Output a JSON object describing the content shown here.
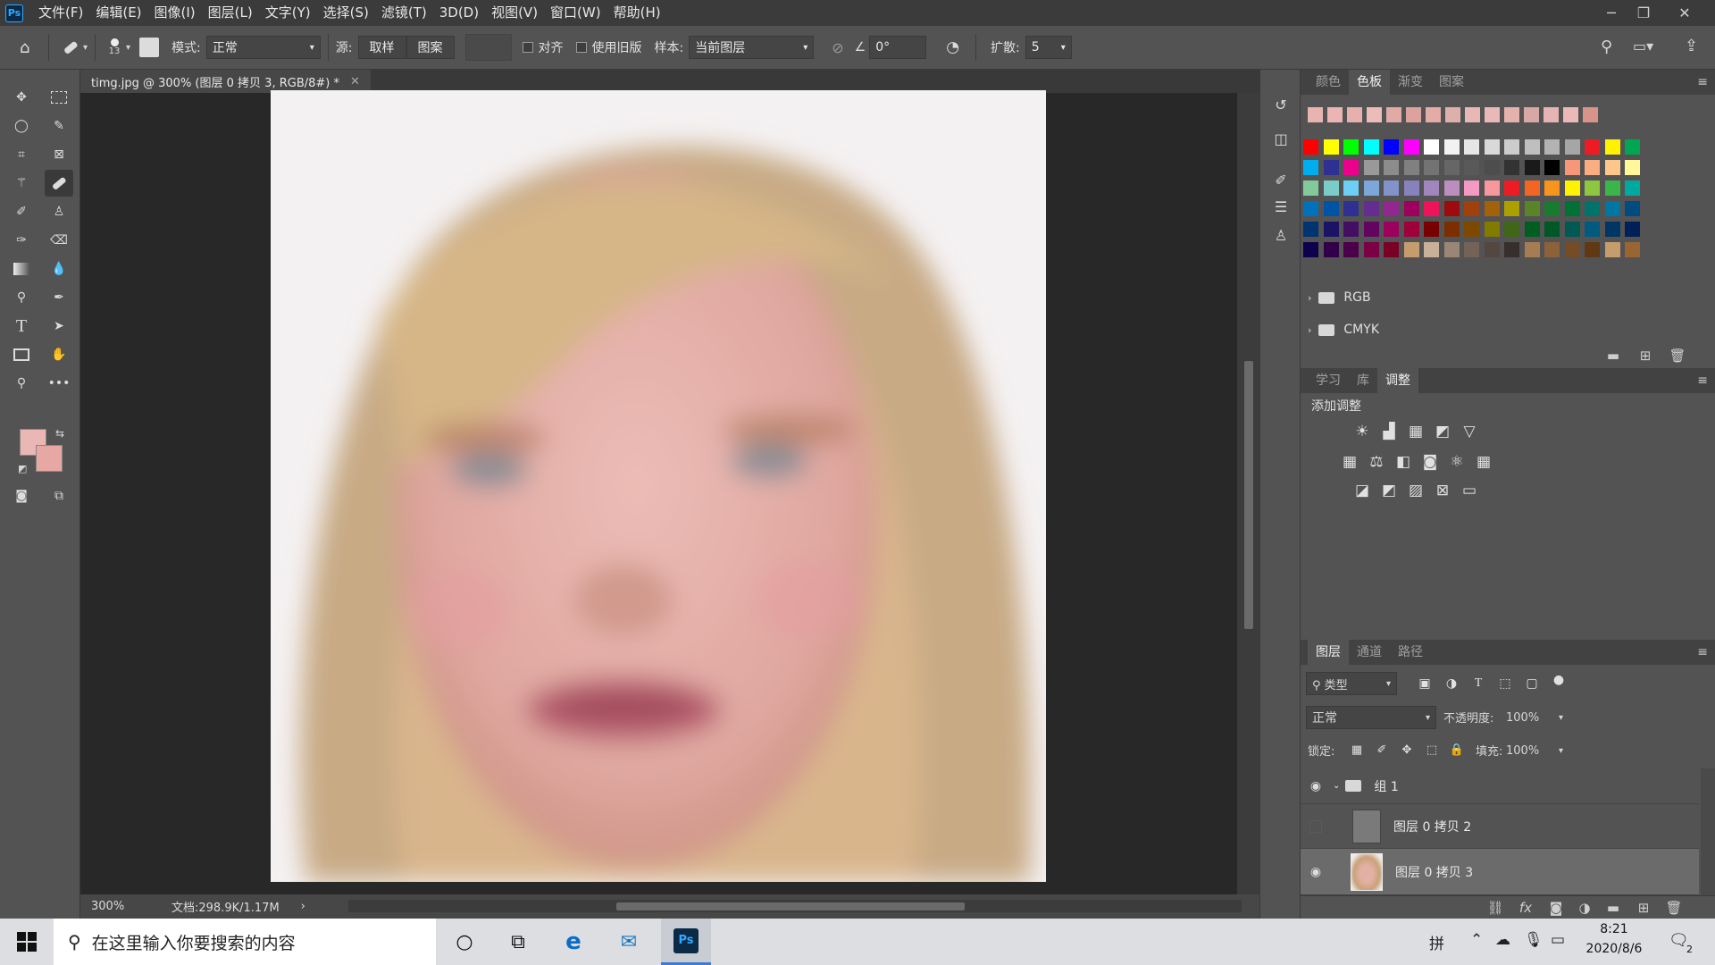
{
  "app": {
    "logo": "Ps"
  },
  "menu": [
    "文件(F)",
    "编辑(E)",
    "图像(I)",
    "图层(L)",
    "文字(Y)",
    "选择(S)",
    "滤镜(T)",
    "3D(D)",
    "视图(V)",
    "窗口(W)",
    "帮助(H)"
  ],
  "options": {
    "brush_size": "13",
    "mode_label": "模式:",
    "mode_value": "正常",
    "source_label": "源:",
    "sample_btn": "取样",
    "pattern_btn": "图案",
    "align_label": "对齐",
    "legacy_label": "使用旧版",
    "sample_label": "样本:",
    "sample_value": "当前图层",
    "angle_value": "0°",
    "diffuse_label": "扩散:",
    "diffuse_value": "5"
  },
  "document": {
    "tab_title": "timg.jpg @ 300% (图层 0 拷贝 3, RGB/8#) *",
    "zoom": "300%",
    "doc_info": "文档:298.9K/1.17M"
  },
  "swatches_panel": {
    "tabs": [
      "颜色",
      "色板",
      "渐变",
      "图案"
    ],
    "active_tab": "色板",
    "recent": [
      "#e8b4b0",
      "#eab5b3",
      "#e6b0ac",
      "#ecbcb8",
      "#e2aaa5",
      "#dca29d",
      "#e4aca7",
      "#deb0ab",
      "#e8b8b4",
      "#eab8b6",
      "#e4b2ad",
      "#d8a8a4",
      "#e6b4b2",
      "#ebb9b8",
      "#d8948a"
    ],
    "grid": [
      [
        "#ff0000",
        "#ffff00",
        "#00ff00",
        "#00ffff",
        "#0000ff",
        "#ff00ff",
        "#ffffff",
        "#f2f2f2",
        "#e6e6e6",
        "#d9d9d9",
        "#cccccc",
        "#bfbfbf",
        "#b3b3b3",
        "#a6a6a6",
        "#ed1c24",
        "#fff200",
        "#00a651"
      ],
      [
        "#00aeef",
        "#2e3192",
        "#ec008c",
        "#999999",
        "#8c8c8c",
        "#808080",
        "#737373",
        "#666666",
        "#595959",
        "#4d4d4d",
        "#333333",
        "#1a1a1a",
        "#000000",
        "#f7977a",
        "#f9ad81",
        "#fdc68a",
        "#fff79a"
      ],
      [
        "#82ca9c",
        "#7accc8",
        "#6dcff6",
        "#7da7d9",
        "#8393ca",
        "#8781bd",
        "#a186be",
        "#bc8dbf",
        "#f49ac2",
        "#f6989d",
        "#ed1c24",
        "#f26522",
        "#f7941d",
        "#fff200",
        "#8dc73f",
        "#39b54a",
        "#00a99d"
      ],
      [
        "#0072bc",
        "#0054a6",
        "#2e3192",
        "#662d91",
        "#92278f",
        "#9e005d",
        "#ed145b",
        "#9e0b0f",
        "#a0410d",
        "#a3620a",
        "#aba000",
        "#598527",
        "#197b30",
        "#007236",
        "#00746b",
        "#0076a3",
        "#004b80"
      ],
      [
        "#003471",
        "#1b1464",
        "#440e62",
        "#630460",
        "#9e005d",
        "#9e0039",
        "#790000",
        "#7b2e00",
        "#7d4900",
        "#827b00",
        "#406618",
        "#005e20",
        "#005826",
        "#005952",
        "#005b7f",
        "#003663",
        "#002157"
      ],
      [
        "#0d004c",
        "#32004b",
        "#4b0049",
        "#7b0046",
        "#7a0026",
        "#c69c6d",
        "#c7b299",
        "#998675",
        "#736357",
        "#534741",
        "#362f2d",
        "#a67c52",
        "#8c6239",
        "#754c24",
        "#603913",
        "#c69c6d",
        "#996633"
      ]
    ],
    "folders": [
      "RGB",
      "CMYK"
    ]
  },
  "adjust_panel": {
    "tabs": [
      "学习",
      "库",
      "调整"
    ],
    "active_tab": "调整",
    "title": "添加调整"
  },
  "layers_panel": {
    "tabs": [
      "图层",
      "通道",
      "路径"
    ],
    "active_tab": "图层",
    "filter_label": "类型",
    "blend_mode": "正常",
    "opacity_label": "不透明度:",
    "opacity_value": "100%",
    "lock_label": "锁定:",
    "fill_label": "填充:",
    "fill_value": "100%",
    "layers": [
      {
        "name": "组 1",
        "visible": true,
        "type": "group"
      },
      {
        "name": "图层 0 拷贝 2",
        "visible": false,
        "type": "layer"
      },
      {
        "name": "图层 0 拷贝 3",
        "visible": true,
        "type": "layer",
        "selected": true
      }
    ]
  },
  "taskbar": {
    "search_placeholder": "在这里输入你要搜索的内容",
    "time": "8:21",
    "date": "2020/8/6",
    "ime": "拼",
    "notifications": "2"
  }
}
